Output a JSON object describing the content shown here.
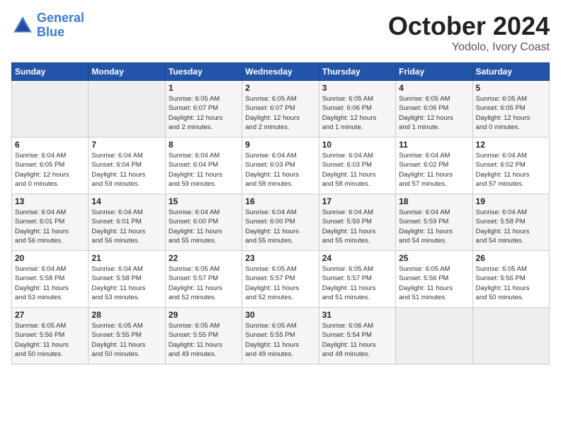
{
  "logo": {
    "line1": "General",
    "line2": "Blue"
  },
  "title": {
    "month": "October 2024",
    "location": "Yodolo, Ivory Coast"
  },
  "headers": [
    "Sunday",
    "Monday",
    "Tuesday",
    "Wednesday",
    "Thursday",
    "Friday",
    "Saturday"
  ],
  "weeks": [
    [
      {
        "day": "",
        "info": ""
      },
      {
        "day": "",
        "info": ""
      },
      {
        "day": "1",
        "info": "Sunrise: 6:05 AM\nSunset: 6:07 PM\nDaylight: 12 hours\nand 2 minutes."
      },
      {
        "day": "2",
        "info": "Sunrise: 6:05 AM\nSunset: 6:07 PM\nDaylight: 12 hours\nand 2 minutes."
      },
      {
        "day": "3",
        "info": "Sunrise: 6:05 AM\nSunset: 6:06 PM\nDaylight: 12 hours\nand 1 minute."
      },
      {
        "day": "4",
        "info": "Sunrise: 6:05 AM\nSunset: 6:06 PM\nDaylight: 12 hours\nand 1 minute."
      },
      {
        "day": "5",
        "info": "Sunrise: 6:05 AM\nSunset: 6:05 PM\nDaylight: 12 hours\nand 0 minutes."
      }
    ],
    [
      {
        "day": "6",
        "info": "Sunrise: 6:04 AM\nSunset: 6:05 PM\nDaylight: 12 hours\nand 0 minutes."
      },
      {
        "day": "7",
        "info": "Sunrise: 6:04 AM\nSunset: 6:04 PM\nDaylight: 11 hours\nand 59 minutes."
      },
      {
        "day": "8",
        "info": "Sunrise: 6:04 AM\nSunset: 6:04 PM\nDaylight: 11 hours\nand 59 minutes."
      },
      {
        "day": "9",
        "info": "Sunrise: 6:04 AM\nSunset: 6:03 PM\nDaylight: 11 hours\nand 58 minutes."
      },
      {
        "day": "10",
        "info": "Sunrise: 6:04 AM\nSunset: 6:03 PM\nDaylight: 11 hours\nand 58 minutes."
      },
      {
        "day": "11",
        "info": "Sunrise: 6:04 AM\nSunset: 6:02 PM\nDaylight: 11 hours\nand 57 minutes."
      },
      {
        "day": "12",
        "info": "Sunrise: 6:04 AM\nSunset: 6:02 PM\nDaylight: 11 hours\nand 57 minutes."
      }
    ],
    [
      {
        "day": "13",
        "info": "Sunrise: 6:04 AM\nSunset: 6:01 PM\nDaylight: 11 hours\nand 56 minutes."
      },
      {
        "day": "14",
        "info": "Sunrise: 6:04 AM\nSunset: 6:01 PM\nDaylight: 11 hours\nand 56 minutes."
      },
      {
        "day": "15",
        "info": "Sunrise: 6:04 AM\nSunset: 6:00 PM\nDaylight: 11 hours\nand 55 minutes."
      },
      {
        "day": "16",
        "info": "Sunrise: 6:04 AM\nSunset: 6:00 PM\nDaylight: 11 hours\nand 55 minutes."
      },
      {
        "day": "17",
        "info": "Sunrise: 6:04 AM\nSunset: 5:59 PM\nDaylight: 11 hours\nand 55 minutes."
      },
      {
        "day": "18",
        "info": "Sunrise: 6:04 AM\nSunset: 5:59 PM\nDaylight: 11 hours\nand 54 minutes."
      },
      {
        "day": "19",
        "info": "Sunrise: 6:04 AM\nSunset: 5:58 PM\nDaylight: 11 hours\nand 54 minutes."
      }
    ],
    [
      {
        "day": "20",
        "info": "Sunrise: 6:04 AM\nSunset: 5:58 PM\nDaylight: 11 hours\nand 53 minutes."
      },
      {
        "day": "21",
        "info": "Sunrise: 6:04 AM\nSunset: 5:58 PM\nDaylight: 11 hours\nand 53 minutes."
      },
      {
        "day": "22",
        "info": "Sunrise: 6:05 AM\nSunset: 5:57 PM\nDaylight: 11 hours\nand 52 minutes."
      },
      {
        "day": "23",
        "info": "Sunrise: 6:05 AM\nSunset: 5:57 PM\nDaylight: 11 hours\nand 52 minutes."
      },
      {
        "day": "24",
        "info": "Sunrise: 6:05 AM\nSunset: 5:57 PM\nDaylight: 11 hours\nand 51 minutes."
      },
      {
        "day": "25",
        "info": "Sunrise: 6:05 AM\nSunset: 5:56 PM\nDaylight: 11 hours\nand 51 minutes."
      },
      {
        "day": "26",
        "info": "Sunrise: 6:05 AM\nSunset: 5:56 PM\nDaylight: 11 hours\nand 50 minutes."
      }
    ],
    [
      {
        "day": "27",
        "info": "Sunrise: 6:05 AM\nSunset: 5:56 PM\nDaylight: 11 hours\nand 50 minutes."
      },
      {
        "day": "28",
        "info": "Sunrise: 6:05 AM\nSunset: 5:55 PM\nDaylight: 11 hours\nand 50 minutes."
      },
      {
        "day": "29",
        "info": "Sunrise: 6:05 AM\nSunset: 5:55 PM\nDaylight: 11 hours\nand 49 minutes."
      },
      {
        "day": "30",
        "info": "Sunrise: 6:05 AM\nSunset: 5:55 PM\nDaylight: 11 hours\nand 49 minutes."
      },
      {
        "day": "31",
        "info": "Sunrise: 6:06 AM\nSunset: 5:54 PM\nDaylight: 11 hours\nand 48 minutes."
      },
      {
        "day": "",
        "info": ""
      },
      {
        "day": "",
        "info": ""
      }
    ]
  ]
}
